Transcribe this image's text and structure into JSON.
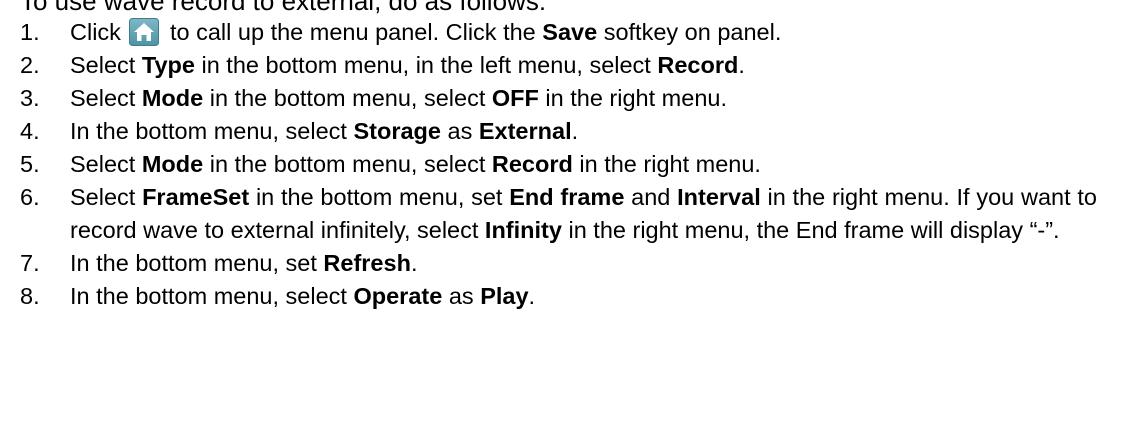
{
  "intro": "To use wave record to external, do as follows:",
  "steps": [
    {
      "num": "1.",
      "parts": [
        {
          "t": "Click "
        },
        {
          "icon": "home-icon"
        },
        {
          "t": " to call up the menu panel. Click the "
        },
        {
          "b": "Save"
        },
        {
          "t": " softkey on panel."
        }
      ]
    },
    {
      "num": "2.",
      "parts": [
        {
          "t": "Select "
        },
        {
          "b": "Type"
        },
        {
          "t": " in the bottom menu, in the left menu, select "
        },
        {
          "b": "Record"
        },
        {
          "t": "."
        }
      ]
    },
    {
      "num": "3.",
      "parts": [
        {
          "t": "Select "
        },
        {
          "b": "Mode"
        },
        {
          "t": " in the bottom menu, select "
        },
        {
          "b": "OFF"
        },
        {
          "t": " in the right menu."
        }
      ]
    },
    {
      "num": "4.",
      "parts": [
        {
          "t": "In the bottom menu, select "
        },
        {
          "b": "Storage"
        },
        {
          "t": " as "
        },
        {
          "b": "External"
        },
        {
          "t": "."
        }
      ]
    },
    {
      "num": "5.",
      "parts": [
        {
          "t": "Select "
        },
        {
          "b": "Mode"
        },
        {
          "t": " in the bottom menu, select "
        },
        {
          "b": "Record"
        },
        {
          "t": " in the right menu."
        }
      ]
    },
    {
      "num": "6.",
      "parts": [
        {
          "t": "Select "
        },
        {
          "b": "FrameSet"
        },
        {
          "t": " in the bottom menu, set "
        },
        {
          "b": "End frame"
        },
        {
          "t": " and "
        },
        {
          "b": "Interval"
        },
        {
          "t": " in the right menu. If you want to record wave to external infinitely, select "
        },
        {
          "b": "Infinity"
        },
        {
          "t": " in the right menu, the End frame will display “-”."
        }
      ]
    },
    {
      "num": "7.",
      "parts": [
        {
          "t": "In the bottom menu, set "
        },
        {
          "b": "Refresh"
        },
        {
          "t": "."
        }
      ]
    },
    {
      "num": "8.",
      "parts": [
        {
          "t": "In the bottom menu, select "
        },
        {
          "b": "Operate"
        },
        {
          "t": " as "
        },
        {
          "b": "Play"
        },
        {
          "t": "."
        }
      ]
    }
  ],
  "colors": {
    "text": "#000000",
    "home_icon_bg": "#4f93a6",
    "home_icon_fg": "#ffffff"
  }
}
